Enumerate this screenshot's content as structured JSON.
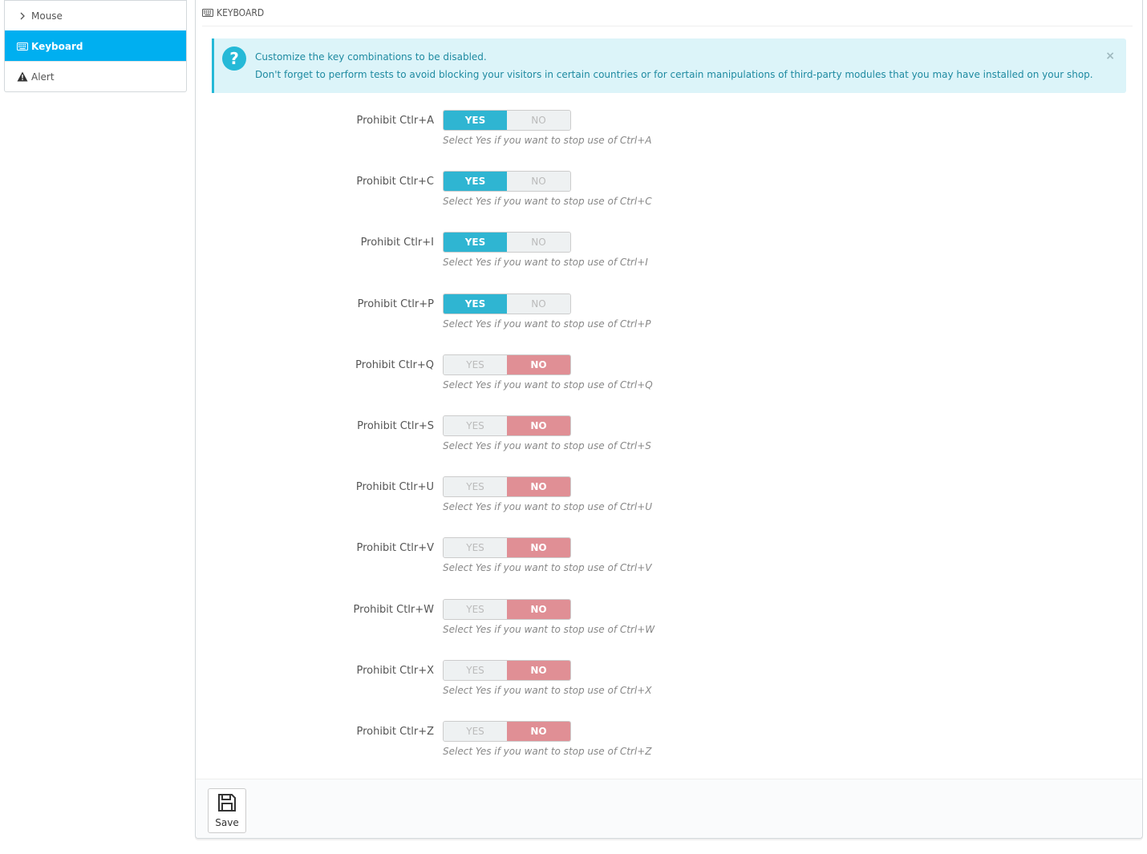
{
  "sidebar": {
    "items": [
      {
        "label": "Mouse",
        "icon": "chevron-right-icon",
        "active": false
      },
      {
        "label": "Keyboard",
        "icon": "keyboard-icon",
        "active": true
      },
      {
        "label": "Alert",
        "icon": "warning-icon",
        "active": false
      }
    ]
  },
  "panel": {
    "title": "KEYBOARD",
    "title_icon": "keyboard-icon"
  },
  "alert": {
    "line1": "Customize the key combinations to be disabled.",
    "line2": "Don't forget to perform tests to avoid blocking your visitors in certain countries or for certain manipulations of third-party modules that you may have installed on your shop.",
    "close": "×"
  },
  "switch_labels": {
    "yes": "YES",
    "no": "NO"
  },
  "colors": {
    "accent": "#00aff0",
    "yes_active": "#2fb5d2",
    "no_active": "#e08f95",
    "alert_bg": "#dcf4f9"
  },
  "settings": [
    {
      "label": "Prohibit Ctlr+A",
      "hint": "Select Yes if you want to stop use of Ctrl+A",
      "value": "YES"
    },
    {
      "label": "Prohibit Ctlr+C",
      "hint": "Select Yes if you want to stop use of Ctrl+C",
      "value": "YES"
    },
    {
      "label": "Prohibit Ctlr+I",
      "hint": "Select Yes if you want to stop use of Ctrl+I",
      "value": "YES"
    },
    {
      "label": "Prohibit Ctlr+P",
      "hint": "Select Yes if you want to stop use of Ctrl+P",
      "value": "YES"
    },
    {
      "label": "Prohibit Ctlr+Q",
      "hint": "Select Yes if you want to stop use of Ctrl+Q",
      "value": "NO"
    },
    {
      "label": "Prohibit Ctlr+S",
      "hint": "Select Yes if you want to stop use of Ctrl+S",
      "value": "NO"
    },
    {
      "label": "Prohibit Ctlr+U",
      "hint": "Select Yes if you want to stop use of Ctrl+U",
      "value": "NO"
    },
    {
      "label": "Prohibit Ctlr+V",
      "hint": "Select Yes if you want to stop use of Ctrl+V",
      "value": "NO"
    },
    {
      "label": "Prohibit Ctlr+W",
      "hint": "Select Yes if you want to stop use of Ctrl+W",
      "value": "NO"
    },
    {
      "label": "Prohibit Ctlr+X",
      "hint": "Select Yes if you want to stop use of Ctrl+X",
      "value": "NO"
    },
    {
      "label": "Prohibit Ctlr+Z",
      "hint": "Select Yes if you want to stop use of Ctrl+Z",
      "value": "NO"
    }
  ],
  "footer": {
    "save_label": "Save",
    "save_icon": "floppy-disk-icon"
  }
}
